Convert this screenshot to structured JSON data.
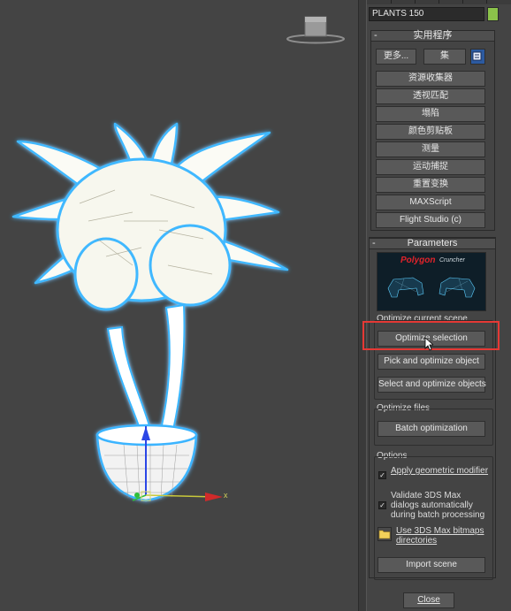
{
  "object_name": "PLANTS 150",
  "swatch_color": "#8bc34a",
  "utilities": {
    "title": "实用程序",
    "more_label": "更多...",
    "sets_label": "集",
    "config_icon": "configure-button-sets-icon",
    "buttons": [
      "资源收集器",
      "透视匹配",
      "塌陷",
      "颜色剪贴板",
      "测量",
      "运动捕捉",
      "重置变换",
      "MAXScript",
      "Flight Studio (c)"
    ]
  },
  "parameters": {
    "title": "Parameters",
    "logo_text": "Polygon",
    "logo_subtext": "Cruncher",
    "optimize_scene_label": "Optimize current scene",
    "optimize_selection_label": "Optimize selection",
    "pick_optimize_label": "Pick and optimize object",
    "select_optimize_label": "Select and optimize objects",
    "files_label": "Optimize files",
    "batch_label": "Batch optimization",
    "options_label": "Options",
    "apply_modifier_label": "Apply geometric modifier",
    "validate_dialogs_label": "Validate 3DS Max dialogs automatically during batch processing",
    "bitmaps_label": "Use 3DS Max bitmaps directories",
    "import_scene_label": "Import scene",
    "close_label": "Close"
  },
  "viewport": {
    "gizmo_x_label": "x"
  },
  "colors": {
    "highlight": "#e53935",
    "accent": "#8bc34a"
  }
}
